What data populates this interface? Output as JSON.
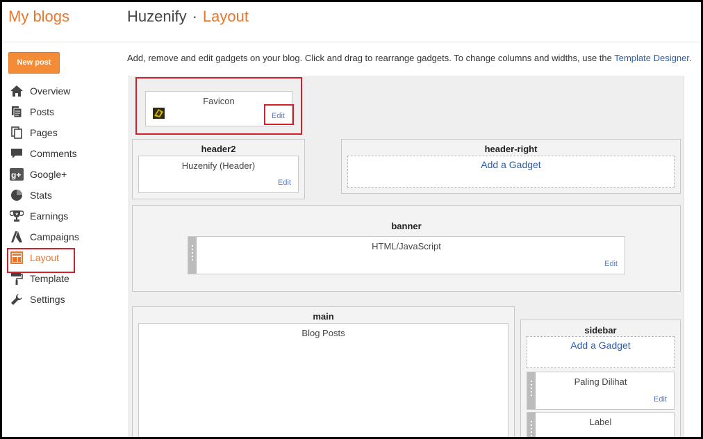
{
  "app": {
    "title": "My blogs"
  },
  "breadcrumb": {
    "blog_name": "Huzenify",
    "separator": "·",
    "current": "Layout"
  },
  "sidebar": {
    "new_post_label": "New post",
    "items": [
      {
        "label": "Overview",
        "icon": "home-icon"
      },
      {
        "label": "Posts",
        "icon": "posts-icon"
      },
      {
        "label": "Pages",
        "icon": "pages-icon"
      },
      {
        "label": "Comments",
        "icon": "comments-icon"
      },
      {
        "label": "Google+",
        "icon": "google-plus-icon"
      },
      {
        "label": "Stats",
        "icon": "stats-icon"
      },
      {
        "label": "Earnings",
        "icon": "trophy-icon"
      },
      {
        "label": "Campaigns",
        "icon": "campaigns-icon"
      },
      {
        "label": "Layout",
        "icon": "layout-icon",
        "active": true
      },
      {
        "label": "Template",
        "icon": "paint-roller-icon"
      },
      {
        "label": "Settings",
        "icon": "wrench-icon"
      }
    ]
  },
  "main": {
    "description": "Add, remove and edit gadgets on your blog. Click and drag to rearrange gadgets. To change columns and widths, use the ",
    "description_link": "Template Designer",
    "description_end": ".",
    "edit_label": "Edit",
    "add_gadget_label": "Add a Gadget",
    "favicon": {
      "name": "Favicon"
    },
    "header2": {
      "title": "header2",
      "gadget": "Huzenify (Header)"
    },
    "header_right": {
      "title": "header-right"
    },
    "banner": {
      "title": "banner",
      "gadget": "HTML/JavaScript"
    },
    "main_section": {
      "title": "main",
      "gadget": "Blog Posts"
    },
    "sidebar_section": {
      "title": "sidebar",
      "gadgets": [
        "Paling Dilihat",
        "Label"
      ]
    }
  },
  "colors": {
    "accent": "#e8772e",
    "link": "#2a5db0",
    "highlight": "#d21f2b",
    "new_post": "#f48b37"
  }
}
